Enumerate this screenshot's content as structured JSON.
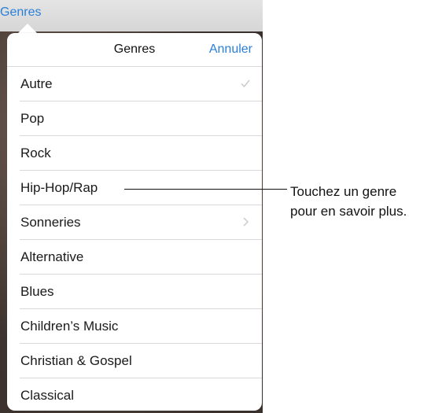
{
  "top_bar": {
    "link_label": "Genres"
  },
  "popover": {
    "title": "Genres",
    "cancel_label": "Annuler",
    "items": [
      {
        "label": "Autre",
        "accessory": "checkmark-icon"
      },
      {
        "label": "Pop",
        "accessory": ""
      },
      {
        "label": "Rock",
        "accessory": ""
      },
      {
        "label": "Hip-Hop/Rap",
        "accessory": ""
      },
      {
        "label": "Sonneries",
        "accessory": "chevron-right-icon"
      },
      {
        "label": "Alternative",
        "accessory": ""
      },
      {
        "label": "Blues",
        "accessory": ""
      },
      {
        "label": "Children’s Music",
        "accessory": ""
      },
      {
        "label": "Christian & Gospel",
        "accessory": ""
      },
      {
        "label": "Classical",
        "accessory": ""
      }
    ]
  },
  "callout": {
    "line1": "Touchez un genre",
    "line2": "pour en savoir plus."
  },
  "colors": {
    "accent": "#2b7fd9",
    "separator": "#d8d8dc",
    "accessory": "#c7c7cc"
  }
}
